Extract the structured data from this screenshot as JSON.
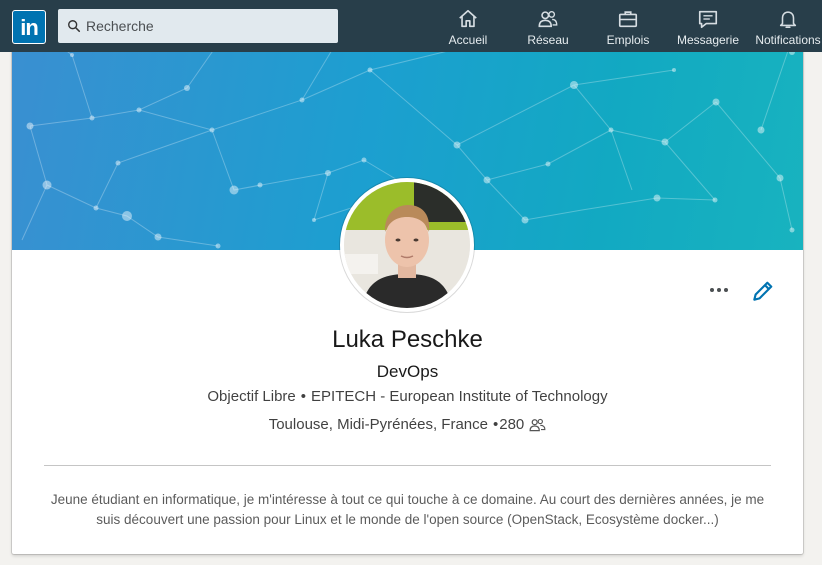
{
  "nav": {
    "logo_text": "in",
    "search_placeholder": "Recherche",
    "items": [
      {
        "label": "Accueil",
        "icon": "home-icon"
      },
      {
        "label": "Réseau",
        "icon": "network-icon"
      },
      {
        "label": "Emplois",
        "icon": "briefcase-icon"
      },
      {
        "label": "Messagerie",
        "icon": "messaging-icon"
      },
      {
        "label": "Notifications",
        "icon": "bell-icon"
      }
    ]
  },
  "profile": {
    "name": "Luka Peschke",
    "headline": "DevOps",
    "company": "Objectif Libre",
    "education": "EPITECH - European Institute of Technology",
    "location": "Toulouse, Midi-Pyrénées, France",
    "connections": "280",
    "summary": "Jeune étudiant en informatique, je m'intéresse à tout ce qui touche à ce domaine. Au court des dernières années, je me suis découvert une passion pour Linux et le monde de l'open source (OpenStack, Ecosystème docker...)"
  },
  "colors": {
    "nav_bg": "#283e4a",
    "brand": "#0073b1",
    "edit_accent": "#0073b1"
  }
}
